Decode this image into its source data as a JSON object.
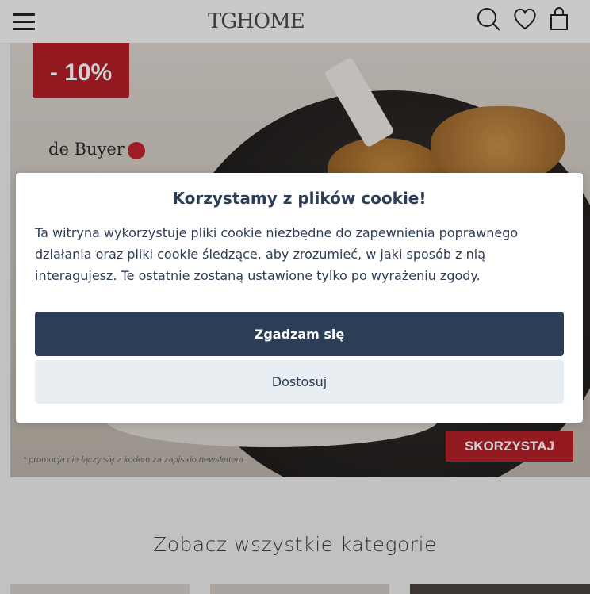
{
  "header": {
    "logo_text": "TGHOME",
    "icons": [
      "menu-icon",
      "search-icon",
      "heart-icon",
      "shopping-bag-icon"
    ]
  },
  "hero": {
    "discount_badge": "- 10%",
    "brand_name": "de Buyer",
    "cta_label": "SKORZYSTAJ",
    "promo_note": "* promocja nie łączy się z kodem za zapis do newslettera"
  },
  "cookie_modal": {
    "title": "Korzystamy z plików cookie!",
    "body": "Ta witryna wykorzystuje pliki cookie niezbędne do zapewnienia poprawnego działania oraz pliki cookie śledzące, aby zrozumieć, w jaki sposób z nią interagujesz. Te ostatnie zostaną ustawione tylko po wyrażeniu zgody.",
    "accept_label": "Zgadzam się",
    "customize_label": "Dostosuj"
  },
  "categories": {
    "title": "Zobacz wszystkie kategorie"
  },
  "colors": {
    "primary": "#2c3e55",
    "secondary_bg": "#e9eef2",
    "promo_red": "#b5202a"
  }
}
